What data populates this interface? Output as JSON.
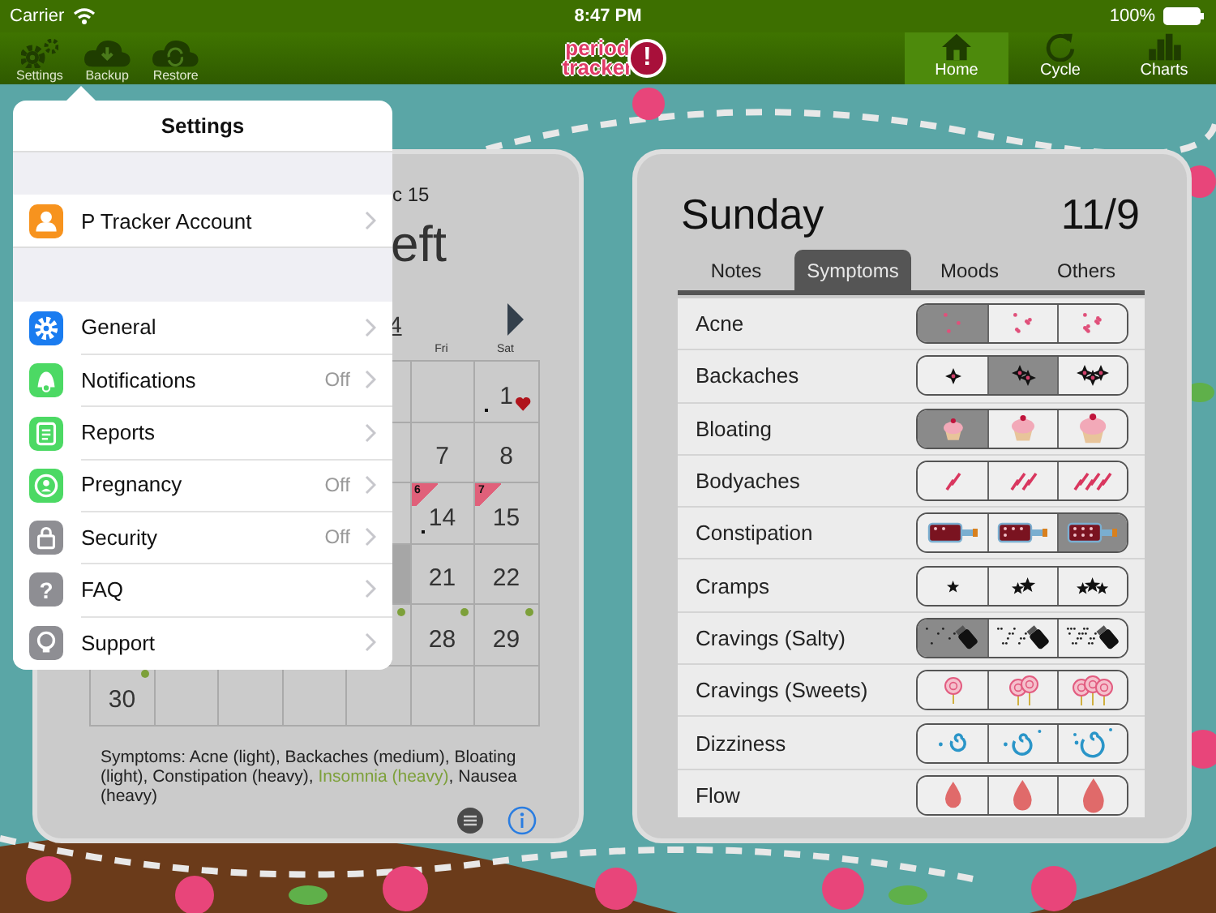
{
  "status_bar": {
    "carrier": "Carrier",
    "time": "8:47 PM",
    "battery": "100%"
  },
  "toolbar": {
    "left_buttons": [
      {
        "label": "Settings"
      },
      {
        "label": "Backup"
      },
      {
        "label": "Restore"
      }
    ],
    "logo": {
      "line_1": "period",
      "line_2": "tracker",
      "mark": "!"
    },
    "nav_tabs": [
      {
        "label": "Home",
        "selected": true
      },
      {
        "label": "Cycle",
        "selected": false
      },
      {
        "label": "Charts",
        "selected": false
      }
    ]
  },
  "calendar_panel": {
    "subtitle": "c 15",
    "headline": "eft",
    "month_fragment": "4",
    "weekday_labels": [
      "Fri",
      "Sat"
    ],
    "weeks": [
      [
        {
          "kind": "blank"
        },
        {
          "kind": "blank"
        },
        {
          "kind": "blank"
        },
        {
          "kind": "blank"
        },
        {
          "kind": "blank"
        },
        {
          "kind": "blank"
        },
        {
          "day": "1",
          "kind": "heart"
        }
      ],
      [
        {
          "kind": "blank"
        },
        {
          "kind": "blank"
        },
        {
          "kind": "blank"
        },
        {
          "kind": "blank"
        },
        {
          "kind": "blank"
        },
        {
          "day": "7",
          "kind": "blank"
        },
        {
          "day": "8",
          "kind": "blank"
        }
      ],
      [
        {
          "kind": "blank"
        },
        {
          "kind": "blank"
        },
        {
          "kind": "blank"
        },
        {
          "kind": "blank"
        },
        {
          "kind": "blank"
        },
        {
          "day": "14",
          "badge": "6",
          "kind": "dot"
        },
        {
          "day": "15",
          "badge": "7",
          "kind": "blank"
        }
      ],
      [
        {
          "kind": "blank"
        },
        {
          "kind": "blank"
        },
        {
          "kind": "blank"
        },
        {
          "kind": "blank"
        },
        {
          "kind": "shaded"
        },
        {
          "day": "21",
          "kind": "blank"
        },
        {
          "day": "22",
          "kind": "blank"
        }
      ],
      [
        {
          "kind": "blank"
        },
        {
          "kind": "blank"
        },
        {
          "kind": "blank"
        },
        {
          "kind": "blank"
        },
        {
          "kind": "indicator"
        },
        {
          "day": "28",
          "kind": "indicator"
        },
        {
          "day": "29",
          "kind": "indicator"
        }
      ],
      [
        {
          "day": "30",
          "kind": "indicator"
        },
        {
          "kind": "blank"
        },
        {
          "kind": "blank"
        },
        {
          "kind": "blank"
        },
        {
          "kind": "blank"
        },
        {
          "kind": "blank"
        },
        {
          "kind": "blank"
        }
      ]
    ],
    "note_parts": [
      {
        "text": "Symptoms:  Acne (light), Backaches (medium), Bloating (light), Constipation (heavy), ",
        "highlighted": false
      },
      {
        "text": "Insomnia (heavy)",
        "highlighted": true
      },
      {
        "text": ", Nausea (heavy)",
        "highlighted": false
      }
    ]
  },
  "day_panel": {
    "weekday": "Sunday",
    "date": "11/9",
    "tabs": [
      {
        "label": "Notes",
        "selected": false
      },
      {
        "label": "Symptoms",
        "selected": true
      },
      {
        "label": "Moods",
        "selected": false
      },
      {
        "label": "Others",
        "selected": false
      }
    ],
    "symptoms": [
      {
        "name": "Acne",
        "kind": "dots",
        "severity": [
          {
            "selected": true
          },
          {
            "selected": false
          },
          {
            "selected": false
          }
        ]
      },
      {
        "name": "Backaches",
        "kind": "sparkle",
        "severity": [
          {
            "selected": false
          },
          {
            "selected": true
          },
          {
            "selected": false
          }
        ]
      },
      {
        "name": "Bloating",
        "kind": "cupcake",
        "severity": [
          {
            "selected": true
          },
          {
            "selected": false
          },
          {
            "selected": false
          }
        ]
      },
      {
        "name": "Bodyaches",
        "kind": "lightning",
        "severity": [
          {
            "selected": false
          },
          {
            "selected": false
          },
          {
            "selected": false
          }
        ]
      },
      {
        "name": "Constipation",
        "kind": "bottle",
        "severity": [
          {
            "selected": false
          },
          {
            "selected": false
          },
          {
            "selected": true
          }
        ]
      },
      {
        "name": "Cramps",
        "kind": "star",
        "severity": [
          {
            "selected": false
          },
          {
            "selected": false
          },
          {
            "selected": false
          }
        ]
      },
      {
        "name": "Cravings (Salty)",
        "kind": "shaker",
        "severity": [
          {
            "selected": true
          },
          {
            "selected": false
          },
          {
            "selected": false
          }
        ]
      },
      {
        "name": "Cravings (Sweets)",
        "kind": "lollipop",
        "severity": [
          {
            "selected": false
          },
          {
            "selected": false
          },
          {
            "selected": false
          }
        ]
      },
      {
        "name": "Dizziness",
        "kind": "swirl",
        "severity": [
          {
            "selected": false
          },
          {
            "selected": false
          },
          {
            "selected": false
          }
        ]
      },
      {
        "name": "Flow",
        "kind": "drop",
        "severity": [
          {
            "selected": false
          },
          {
            "selected": false
          },
          {
            "selected": false
          }
        ]
      }
    ]
  },
  "settings_menu": {
    "title": "Settings",
    "sections": [
      {
        "items": [
          {
            "label": "P Tracker Account",
            "color": "#f7931e"
          }
        ]
      },
      {
        "items": [
          {
            "label": "General",
            "color": "#1a7cf0"
          },
          {
            "label": "Notifications",
            "color": "#4cd964",
            "value": "Off"
          },
          {
            "label": "Reports",
            "color": "#4cd964"
          },
          {
            "label": "Pregnancy",
            "color": "#4cd964",
            "value": "Off"
          },
          {
            "label": "Security",
            "color": "#8e8e93",
            "value": "Off"
          },
          {
            "label": "FAQ",
            "glyph": "?",
            "color": "#8e8e93"
          },
          {
            "label": "Support",
            "color": "#8e8e93"
          }
        ]
      }
    ]
  }
}
